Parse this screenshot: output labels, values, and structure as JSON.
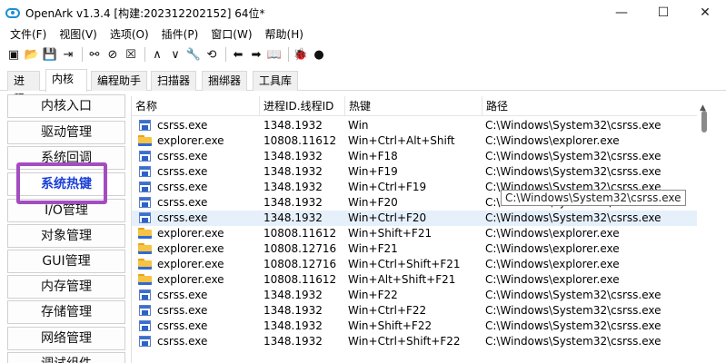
{
  "window": {
    "title": "OpenArk v1.3.4 [构建:202312202152]  64位*",
    "minimize_glyph": "—",
    "maximize_glyph": "☐",
    "close_glyph": "✕"
  },
  "menu": {
    "items": [
      "文件(F)",
      "视图(V)",
      "选项(O)",
      "插件(P)",
      "窗口(W)",
      "帮助(H)"
    ]
  },
  "toolbar": {
    "icons": [
      "console-icon",
      "open-folder-icon",
      "save-icon",
      "export-icon",
      "link-icon",
      "stop-icon",
      "close-box-icon",
      "up-icon",
      "down-icon",
      "wrench-icon",
      "refresh-icon",
      "back-arrow-icon",
      "forward-arrow-icon",
      "book-icon",
      "bug-icon",
      "github-icon"
    ],
    "glyphs": [
      "▣",
      "📂",
      "💾",
      "⇥",
      "⚯",
      "⊘",
      "☒",
      "∧",
      "∨",
      "🔧",
      "⟲",
      "⬅",
      "➡",
      "📖",
      "🐞",
      "●"
    ]
  },
  "tabs": [
    "进程",
    "内核",
    "编程助手",
    "扫描器",
    "捆绑器",
    "工具库"
  ],
  "active_tab": "内核",
  "nav": {
    "items": [
      "内核入口",
      "驱动管理",
      "系统回调",
      "系统热键",
      "I/O管理",
      "对象管理",
      "GUI管理",
      "内存管理",
      "存储管理",
      "网络管理",
      "调试组件"
    ],
    "active": "系统热键"
  },
  "list": {
    "columns": [
      "名称",
      "进程ID.线程ID",
      "热键",
      "路径"
    ],
    "rows": [
      {
        "icon": "exe",
        "name": "csrss.exe",
        "pid": "1348.1932",
        "hotkey": "Win",
        "path": "C:\\Windows\\System32\\csrss.exe"
      },
      {
        "icon": "folder",
        "name": "explorer.exe",
        "pid": "10808.11612",
        "hotkey": "Win+Ctrl+Alt+Shift",
        "path": "C:\\Windows\\explorer.exe"
      },
      {
        "icon": "exe",
        "name": "csrss.exe",
        "pid": "1348.1932",
        "hotkey": "Win+F18",
        "path": "C:\\Windows\\System32\\csrss.exe"
      },
      {
        "icon": "exe",
        "name": "csrss.exe",
        "pid": "1348.1932",
        "hotkey": "Win+F19",
        "path": "C:\\Windows\\System32\\csrss.exe"
      },
      {
        "icon": "exe",
        "name": "csrss.exe",
        "pid": "1348.1932",
        "hotkey": "Win+Ctrl+F19",
        "path": "C:\\Windows\\System32\\csrss.exe"
      },
      {
        "icon": "exe",
        "name": "csrss.exe",
        "pid": "1348.1932",
        "hotkey": "Win+F20",
        "path": "C:\\Windows\\System32\\csrss.exe"
      },
      {
        "icon": "exe",
        "name": "csrss.exe",
        "pid": "1348.1932",
        "hotkey": "Win+Ctrl+F20",
        "path": "C:\\Windows\\System32\\csrss.exe"
      },
      {
        "icon": "folder",
        "name": "explorer.exe",
        "pid": "10808.11612",
        "hotkey": "Win+Shift+F21",
        "path": "C:\\Windows\\explorer.exe"
      },
      {
        "icon": "folder",
        "name": "explorer.exe",
        "pid": "10808.12716",
        "hotkey": "Win+F21",
        "path": "C:\\Windows\\explorer.exe"
      },
      {
        "icon": "folder",
        "name": "explorer.exe",
        "pid": "10808.12716",
        "hotkey": "Win+Ctrl+Shift+F21",
        "path": "C:\\Windows\\explorer.exe"
      },
      {
        "icon": "folder",
        "name": "explorer.exe",
        "pid": "10808.11612",
        "hotkey": "Win+Alt+Shift+F21",
        "path": "C:\\Windows\\explorer.exe"
      },
      {
        "icon": "exe",
        "name": "csrss.exe",
        "pid": "1348.1932",
        "hotkey": "Win+F22",
        "path": "C:\\Windows\\System32\\csrss.exe"
      },
      {
        "icon": "exe",
        "name": "csrss.exe",
        "pid": "1348.1932",
        "hotkey": "Win+Ctrl+F22",
        "path": "C:\\Windows\\System32\\csrss.exe"
      },
      {
        "icon": "exe",
        "name": "csrss.exe",
        "pid": "1348.1932",
        "hotkey": "Win+Shift+F22",
        "path": "C:\\Windows\\System32\\csrss.exe"
      },
      {
        "icon": "exe",
        "name": "csrss.exe",
        "pid": "1348.1932",
        "hotkey": "Win+Ctrl+Shift+F22",
        "path": "C:\\Windows\\System32\\csrss.exe"
      }
    ],
    "selected_row": 6
  },
  "tooltip": {
    "text": "C:\\Windows\\System32\\csrss.exe"
  },
  "colors": {
    "highlight_box": "#a34dc0",
    "active_nav_text": "#1a3fd6",
    "selected_row": "#e6f0fb"
  }
}
